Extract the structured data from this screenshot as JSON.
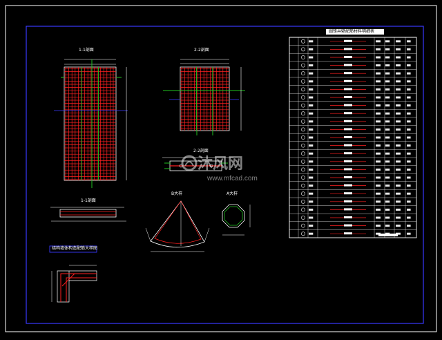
{
  "colors": {
    "background": "#000000",
    "frame": "#3a3aff",
    "rebar": "#ff2020",
    "rebar_green": "#21c521",
    "line": "#ffffff",
    "table_text": "#e8e8e8"
  },
  "views": {
    "view1_title": "1-1剖面",
    "view2_title": "2-2剖面",
    "view3_title": "2-2剖面",
    "section_title": "1-1剖面",
    "detail_b_title": "B大样",
    "detail_a_title": "A大样",
    "detail_corner_title": "结构墙体构造配筋大样图"
  },
  "table": {
    "title": "圆锥井壁配筋材料明细表",
    "rows": 25
  },
  "status": {
    "watermark_main": "沐风网",
    "watermark_sub": "www.mfcad.com"
  }
}
